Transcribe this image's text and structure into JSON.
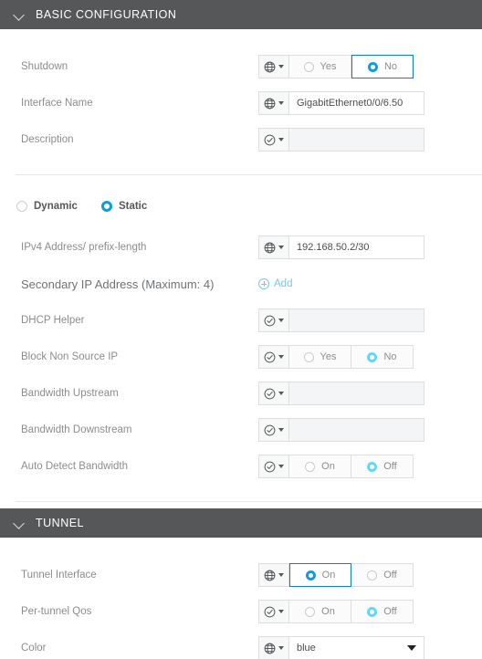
{
  "sections": [
    {
      "id": "basic",
      "title": "BASIC CONFIGURATION",
      "chevron_icon": "chevron-down-icon"
    },
    {
      "id": "tunnel",
      "title": "TUNNEL",
      "chevron_icon": "chevron-down-icon"
    }
  ],
  "basic": {
    "shutdown": {
      "label": "Shutdown",
      "scope_icon": "globe-icon",
      "options": [
        "Yes",
        "No"
      ],
      "selected": "No"
    },
    "interface_name": {
      "label": "Interface Name",
      "scope_icon": "globe-icon",
      "value": "GigabitEthernet0/0/6.50",
      "placeholder": ""
    },
    "description": {
      "label": "Description",
      "scope_icon": "check-circle-icon",
      "value": "",
      "placeholder": ""
    },
    "addr_mode": {
      "options": [
        "Dynamic",
        "Static"
      ],
      "selected": "Static"
    },
    "ipv4_address": {
      "label": "IPv4 Address/ prefix-length",
      "scope_icon": "globe-icon",
      "value": "192.168.50.2/30",
      "placeholder": ""
    },
    "secondary_ip": {
      "label": "Secondary IP Address (Maximum: 4)",
      "add_label": "Add",
      "add_icon": "plus-circle-icon"
    },
    "dhcp_helper": {
      "label": "DHCP Helper",
      "scope_icon": "check-circle-icon",
      "value": "",
      "placeholder": ""
    },
    "block_non_source_ip": {
      "label": "Block Non Source IP",
      "scope_icon": "check-circle-icon",
      "options": [
        "Yes",
        "No"
      ],
      "selected": "No"
    },
    "bandwidth_upstream": {
      "label": "Bandwidth Upstream",
      "scope_icon": "check-circle-icon",
      "value": "",
      "placeholder": ""
    },
    "bandwidth_downstream": {
      "label": "Bandwidth Downstream",
      "scope_icon": "check-circle-icon",
      "value": "",
      "placeholder": ""
    },
    "auto_detect_bandwidth": {
      "label": "Auto Detect Bandwidth",
      "scope_icon": "check-circle-icon",
      "options": [
        "On",
        "Off"
      ],
      "selected": "Off"
    }
  },
  "tunnel": {
    "tunnel_interface": {
      "label": "Tunnel Interface",
      "scope_icon": "globe-icon",
      "options": [
        "On",
        "Off"
      ],
      "selected": "On"
    },
    "per_tunnel_qos": {
      "label": "Per-tunnel Qos",
      "scope_icon": "check-circle-icon",
      "options": [
        "On",
        "Off"
      ],
      "selected": "Off"
    },
    "color": {
      "label": "Color",
      "scope_icon": "globe-icon",
      "value": "blue",
      "placeholder": "",
      "caret_icon": "chevron-down-icon"
    }
  },
  "colors": {
    "section_header_bg": "#555759",
    "accent_blue": "#0d9ddb",
    "accent_blue_border": "#0d7fc4",
    "accent_soft_cyan": "#66d7f2",
    "link_blue": "#78c8ea",
    "label_grey": "#8a8d8f"
  }
}
